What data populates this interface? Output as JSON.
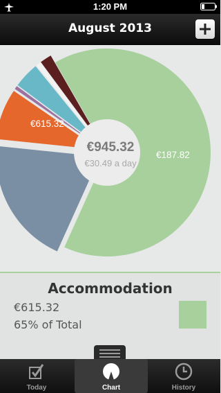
{
  "status_bar": {
    "time": "1:20 PM"
  },
  "nav": {
    "title": "August 2013",
    "add_label": "+"
  },
  "chart": {
    "total": "€945.32",
    "daily": "€30.49 a day",
    "slice_labels": {
      "accommodation": "€615.32",
      "second": "€187.82"
    }
  },
  "chart_data": {
    "type": "pie",
    "total": 945.32,
    "slices": [
      {
        "key": "accommodation",
        "value": 615.32,
        "color": "#a7d09d"
      },
      {
        "key": "second",
        "value": 187.82,
        "color": "#7a8ea4"
      },
      {
        "key": "third",
        "value": 75.0,
        "color": "#e5672b"
      },
      {
        "key": "fourth",
        "value": 5.0,
        "color": "#9b72a0"
      },
      {
        "key": "fifth",
        "value": 38.0,
        "color": "#68b8c8"
      },
      {
        "key": "sixth",
        "value": 7.0,
        "color": "#f2f2f2"
      },
      {
        "key": "seventh",
        "value": 17.18,
        "color": "#5c1f1f"
      }
    ]
  },
  "detail": {
    "category": "Accommodation",
    "amount": "€615.32",
    "percent": "65% of Total",
    "color": "#a7d09d"
  },
  "tabs": [
    {
      "label": "Today",
      "icon": "checkbox-icon"
    },
    {
      "label": "Chart",
      "icon": "pie-chart-icon"
    },
    {
      "label": "History",
      "icon": "clock-icon"
    }
  ],
  "active_tab": "Chart"
}
